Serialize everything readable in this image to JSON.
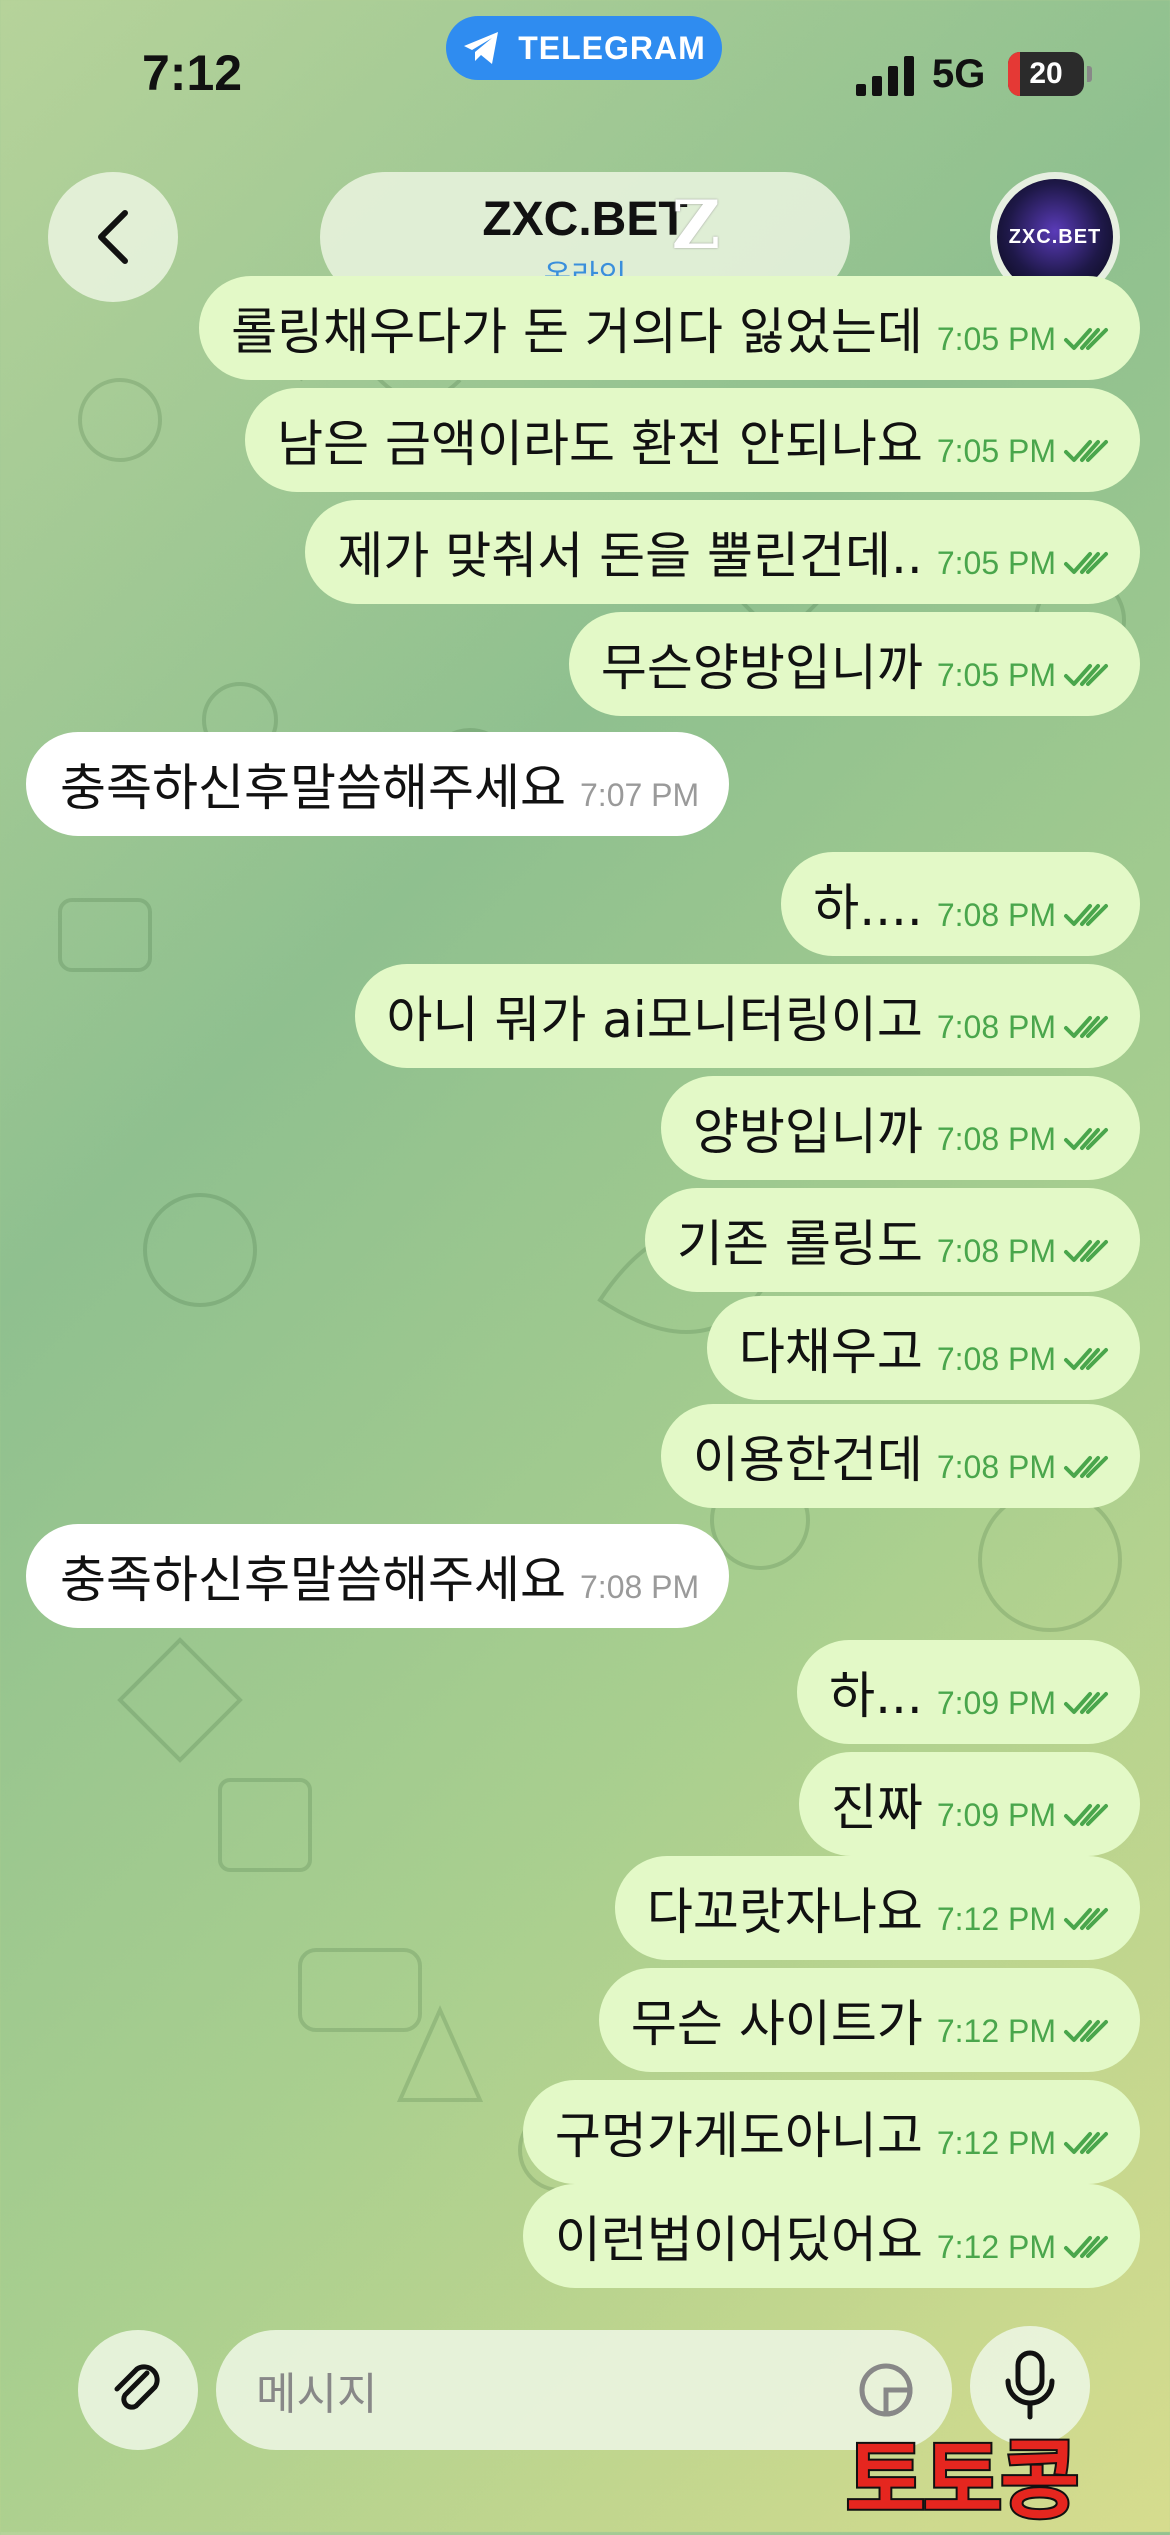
{
  "status_bar": {
    "time": "7:12",
    "app_pill": "TELEGRAM",
    "network": "5G",
    "battery": "20"
  },
  "header": {
    "title": "ZXC.BET",
    "title_mark": "Z",
    "status": "온라인",
    "avatar_text": "ZXC.BET"
  },
  "messages": [
    {
      "dir": "out",
      "text": "롤링채우다가 돈 거의다 잃었는데",
      "time": "7:05 PM"
    },
    {
      "dir": "out",
      "text": "남은 금액이라도 환전 안되나요",
      "time": "7:05 PM"
    },
    {
      "dir": "out",
      "text": "제가 맞춰서 돈을 뿔린건데..",
      "time": "7:05 PM"
    },
    {
      "dir": "out",
      "text": "무슨양방입니까",
      "time": "7:05 PM"
    },
    {
      "dir": "in",
      "text": "충족하신후말씀해주세요",
      "time": "7:07 PM"
    },
    {
      "dir": "out",
      "text": "하....",
      "time": "7:08 PM"
    },
    {
      "dir": "out",
      "text": "아니 뭐가 ai모니터링이고",
      "time": "7:08 PM"
    },
    {
      "dir": "out",
      "text": "양방입니까",
      "time": "7:08 PM"
    },
    {
      "dir": "out",
      "text": "기존 롤링도",
      "time": "7:08 PM"
    },
    {
      "dir": "out",
      "text": "다채우고",
      "time": "7:08 PM"
    },
    {
      "dir": "out",
      "text": "이용한건데",
      "time": "7:08 PM"
    },
    {
      "dir": "in",
      "text": "충족하신후말씀해주세요",
      "time": "7:08 PM"
    },
    {
      "dir": "out",
      "text": "하...",
      "time": "7:09 PM"
    },
    {
      "dir": "out",
      "text": "진짜",
      "time": "7:09 PM"
    },
    {
      "dir": "out",
      "text": "다꼬랏자나요",
      "time": "7:12 PM"
    },
    {
      "dir": "out",
      "text": "무슨 사이트가",
      "time": "7:12 PM"
    },
    {
      "dir": "out",
      "text": "구멍가게도아니고",
      "time": "7:12 PM"
    },
    {
      "dir": "out",
      "text": "이런법이어딨어요",
      "time": "7:12 PM"
    }
  ],
  "input": {
    "placeholder": "메시지"
  },
  "watermark": "토토콩",
  "colors": {
    "outgoing_bubble": "#e3f9c7",
    "incoming_bubble": "#ffffff",
    "accent": "#2f8cf0",
    "read_check": "#4aa64c"
  }
}
